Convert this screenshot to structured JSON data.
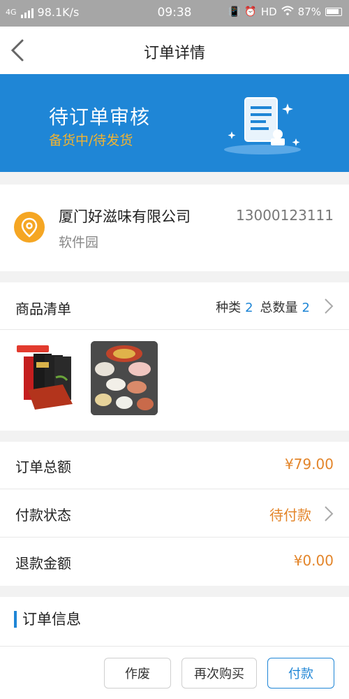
{
  "status_bar": {
    "network": "4G",
    "speed": "98.1K/s",
    "time": "09:38",
    "hd": "HD",
    "battery": "87%"
  },
  "nav": {
    "title": "订单详情",
    "back_icon": "chevron-left-icon"
  },
  "banner": {
    "title": "待订单审核",
    "subtitle": "备货中/待发货",
    "illustration_icon": "order-review-icon",
    "background": "#1f86d6",
    "subtitle_color": "#f2b431"
  },
  "address": {
    "name": "厦门好滋味有限公司",
    "phone": "13000123111",
    "detail": "软件园",
    "icon": "location-pin-icon",
    "icon_color": "#f5a623"
  },
  "goods": {
    "title": "商品清单",
    "types_label": "种类",
    "types_value": "2",
    "quantity_label": "总数量",
    "quantity_value": "2",
    "thumbnails": [
      "hotpot-seasoning-product",
      "hotpot-spread-product"
    ]
  },
  "summary": {
    "total_label": "订单总额",
    "total_value": "¥79.00",
    "payment_status_label": "付款状态",
    "payment_status_value": "待付款",
    "refund_label": "退款金额",
    "refund_value": "¥0.00",
    "value_color": "#e3852a"
  },
  "info": {
    "title": "订单信息"
  },
  "actions": {
    "void_label": "作废",
    "rebuy_label": "再次购买",
    "pay_label": "付款"
  }
}
